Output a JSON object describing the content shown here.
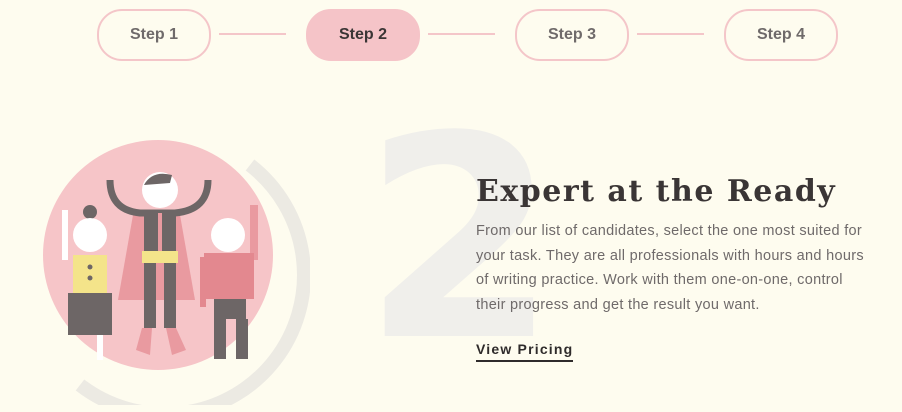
{
  "steps": [
    {
      "label": "Step 1"
    },
    {
      "label": "Step 2"
    },
    {
      "label": "Step 3"
    },
    {
      "label": "Step 4"
    }
  ],
  "active_step": 2,
  "feature": {
    "number": "2",
    "title": "Expert at the Ready",
    "description": "From our list of candidates, select the one most suited for your task. They are all professionals with hours and hours of writing practice. Work with them one-on-one, control their progress and get the result you want.",
    "cta_label": "View Pricing"
  },
  "colors": {
    "background": "#fefcef",
    "accent_pink": "#f5c4c8",
    "text_dark": "#3a3535",
    "text_muted": "#6f6a6a"
  }
}
